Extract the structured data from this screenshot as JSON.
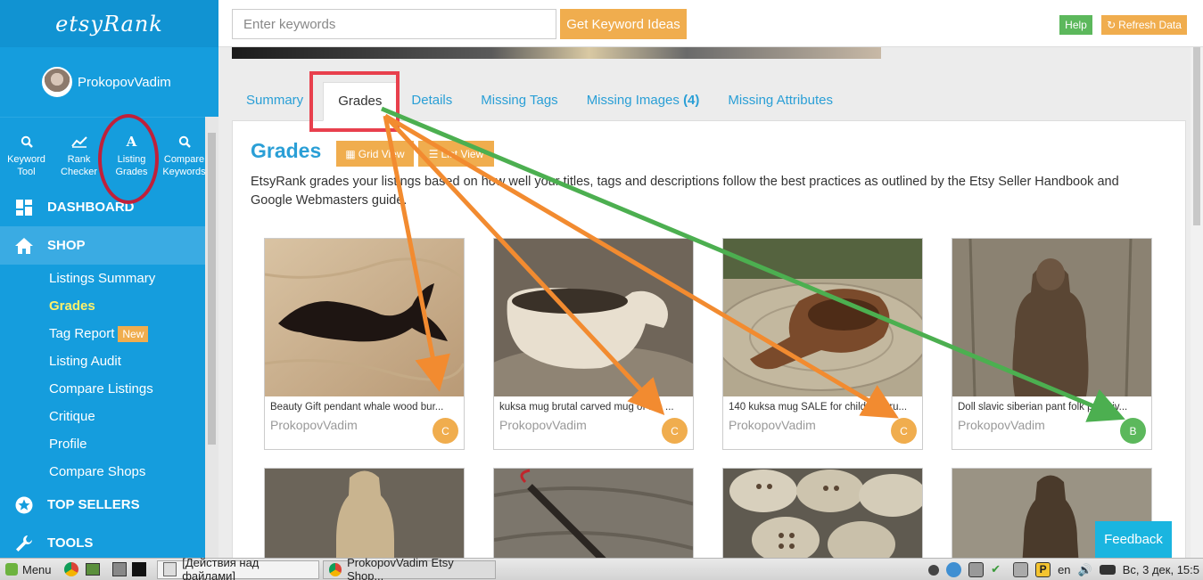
{
  "sidebar": {
    "logo": "etsyRank",
    "username": "ProkopovVadim",
    "tools": [
      {
        "icon": "search-icon",
        "line1": "Keyword",
        "line2": "Tool"
      },
      {
        "icon": "chart-icon",
        "line1": "Rank",
        "line2": "Checker"
      },
      {
        "icon": "grade-icon",
        "line1": "Listing",
        "line2": "Grades"
      },
      {
        "icon": "search-icon",
        "line1": "Compare",
        "line2": "Keywords"
      }
    ],
    "dashboard": "DASHBOARD",
    "shop": "SHOP",
    "submenu": [
      "Listings Summary",
      "Grades",
      "Tag Report",
      "Listing Audit",
      "Compare Listings",
      "Critique",
      "Profile",
      "Compare Shops"
    ],
    "new_badge": "New",
    "top_sellers": "TOP SELLERS",
    "tools_menu": "TOOLS"
  },
  "topbar": {
    "keyword_placeholder": "Enter keywords",
    "get_ideas": "Get Keyword Ideas",
    "help": "Help",
    "refresh": "Refresh Data"
  },
  "tabs": {
    "summary": "Summary",
    "grades": "Grades",
    "details": "Details",
    "missing_tags": "Missing Tags",
    "missing_images": "Missing Images",
    "missing_images_count": "(4)",
    "missing_attributes": "Missing Attributes"
  },
  "panel": {
    "title": "Grades",
    "grid_view": "Grid View",
    "list_view": "List View",
    "description": "EtsyRank grades your listings based on how well your titles, tags and descriptions follow the best practices as outlined by the Etsy Seller Handbook and Google Webmasters guide."
  },
  "cards": [
    {
      "title": "Beauty Gift pendant whale wood bur...",
      "shop": "ProkopovVadim",
      "grade": "C"
    },
    {
      "title": "kuksa mug brutal carved mug of the ...",
      "shop": "ProkopovVadim",
      "grade": "C"
    },
    {
      "title": "140 kuksa mug SALE for children bru...",
      "shop": "ProkopovVadim",
      "grade": "C"
    },
    {
      "title": "Doll slavic siberian pant folk primitiv...",
      "shop": "ProkopovVadim",
      "grade": "B"
    }
  ],
  "colors": {
    "grade_c": "#f0ad4e",
    "grade_b": "#5cb85c",
    "accent": "#159ddd"
  },
  "feedback": "Feedback",
  "taskbar": {
    "menu": "Menu",
    "window1": "[Действия над файлами]",
    "window2": "ProkopovVadim Etsy Shop...",
    "lang": "en",
    "clock": "Вс, 3 дек, 15:5"
  }
}
